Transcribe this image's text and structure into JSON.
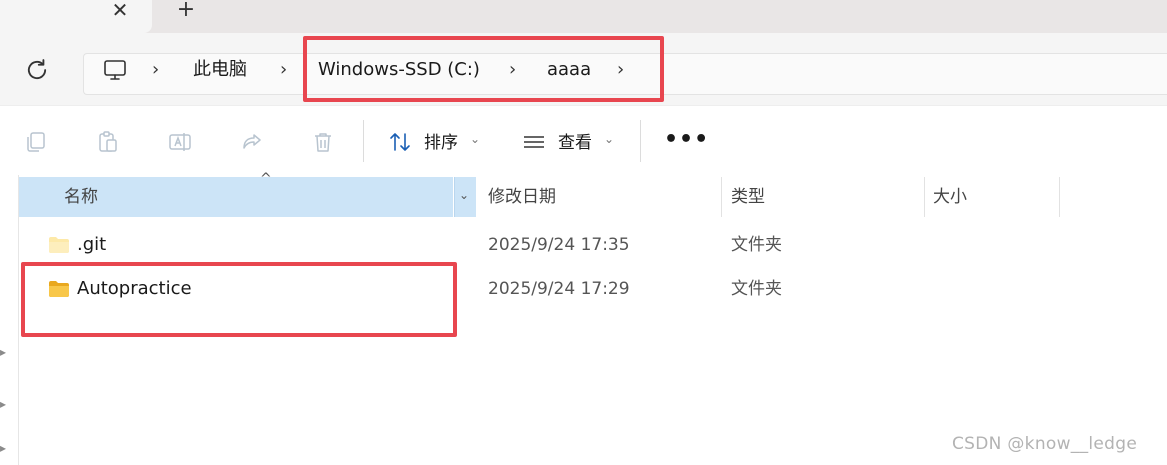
{
  "tabs": {
    "close_glyph": "✕",
    "new_glyph": "+"
  },
  "breadcrumb": {
    "items": [
      "此电脑",
      "Windows-SSD (C:)",
      "aaaa"
    ],
    "separator": "›"
  },
  "toolbar": {
    "sort_label": "排序",
    "view_label": "查看",
    "more_label": "•••",
    "caret": "⌄"
  },
  "columns": {
    "name": "名称",
    "date": "修改日期",
    "type": "类型",
    "size": "大小"
  },
  "files": [
    {
      "name": ".git",
      "date": "2025/9/24 17:35",
      "type": "文件夹"
    },
    {
      "name": "Autopractice",
      "date": "2025/9/24 17:29",
      "type": "文件夹"
    }
  ],
  "watermark": "CSDN @know__ledge",
  "colors": {
    "highlight": "#e8464f",
    "header_selected": "#cce4f7",
    "folder": "#f8c74a"
  }
}
